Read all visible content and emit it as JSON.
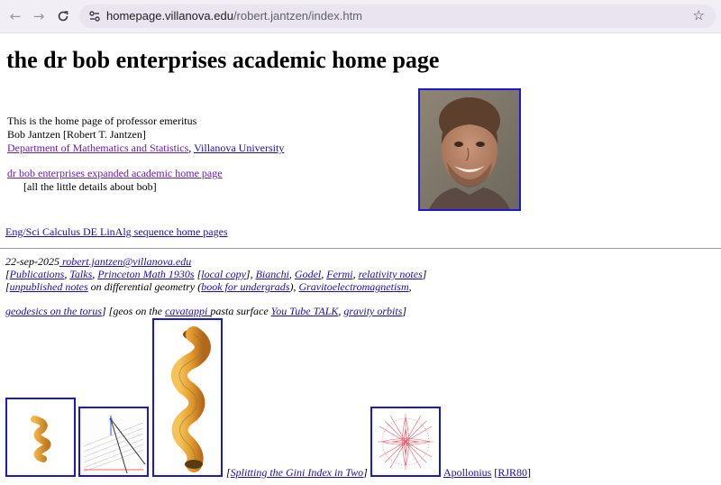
{
  "browser": {
    "url_domain": "homepage.villanova.edu",
    "url_path": "/robert.jantzen/index.htm"
  },
  "page": {
    "title": "the dr bob enterprises academic home page",
    "intro_line1": "This is the home page of  professor emeritus",
    "intro_line2": "Bob Jantzen [Robert T. Jantzen]",
    "dept_link": "Department of Mathematics and Statistics",
    "comma": ", ",
    "univ_link": "Villanova University",
    "expanded_link": "dr bob enterprises expanded academic home page",
    "expanded_desc": "[all the little details about bob]",
    "eng_link": "Eng/Sci Calculus DE LinAlg sequence home pages",
    "date": "22-sep-2025",
    "email": " robert.jantzen@villanova.edu",
    "line2": {
      "open": "[",
      "publications": "Publications",
      "sep1": ", ",
      "talks": "Talks",
      "sep2": ", ",
      "princeton": "Princeton Math 1930s",
      "lb": " [",
      "local_copy": "local copy",
      "rb": "], ",
      "bianchi": "Bianchi",
      "sep3": ", ",
      "godel": "Godel",
      "sep4": ", ",
      "fermi": "Fermi",
      "sep5": ", ",
      "relativity": "relativity notes",
      "close": "]"
    },
    "line3": {
      "open": "[",
      "unpublished": "unpublished notes",
      "mid": " on differential geometry (",
      "book": "book for undergrads",
      "mid2": "), ",
      "gravito": "Gravitoelectromagnetism",
      "end": ","
    },
    "line4": {
      "geodesics": " geodesics on the torus",
      "mid": "] [geos on the ",
      "cavatappi": "cavatappi ",
      "mid2": "pasta surface ",
      "youtube": "You Tube TALK",
      "sep": ", ",
      "gravity": "gravity orbits",
      "close": "]"
    },
    "gini": {
      "open": "[",
      "link": "Splitting the Gini Index in Two",
      "close": "]"
    },
    "apollonius": {
      "link": "Apollonius",
      "open": " [",
      "rjr": "RJR80",
      "close": "]"
    }
  }
}
